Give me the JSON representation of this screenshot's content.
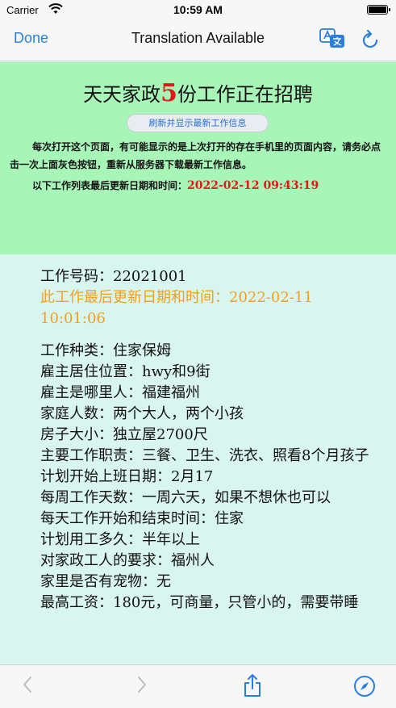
{
  "status_bar": {
    "carrier": "Carrier",
    "time": "10:59 AM"
  },
  "nav": {
    "done": "Done",
    "title": "Translation Available"
  },
  "banner": {
    "title_pre": "天天家政",
    "title_num": "5",
    "title_post": "份工作正在招聘",
    "refresh_button": "刷新并显示最新工作信息",
    "note": "每次打开这个页面，有可能显示的是上次打开的存在手机里的页面内容，请务必点击一次上面灰色按钮，重新从服务器下载最新工作信息。",
    "update_label": "以下工作列表最后更新日期和时间：",
    "update_datetime": "2022-02-12 09:43:19"
  },
  "job": {
    "number": "工作号码：22021001",
    "updated": "此工作最后更新日期和时间：2022-02-11 10:01:06",
    "fields": [
      "工作种类：住家保姆",
      "雇主居住位置：hwy和9街",
      "雇主是哪里人：福建福州",
      "家庭人数：两个大人，两个小孩",
      "房子大小：独立屋2700尺",
      "主要工作职责：三餐、卫生、洗衣、照看8个月孩子",
      "计划开始上班日期：2月17",
      "每周工作天数：一周六天，如果不想休也可以",
      "每天工作开始和结束时间：住家",
      "计划用工多久：半年以上",
      "对家政工人的要求：福州人",
      "家里是否有宠物：无",
      "最高工资：180元，可商量，只管小的，需要带睡"
    ]
  },
  "colors": {
    "accent": "#2a7de1",
    "banner_bg": "#a8f5b8",
    "content_bg": "#d9f5ef",
    "highlight_red": "#e01818",
    "updated_orange": "#f0a020"
  },
  "icons": {
    "translate": "translate-icon",
    "refresh": "refresh-icon",
    "back": "chevron-left-icon",
    "forward": "chevron-right-icon",
    "share": "share-icon",
    "compass": "compass-icon"
  }
}
